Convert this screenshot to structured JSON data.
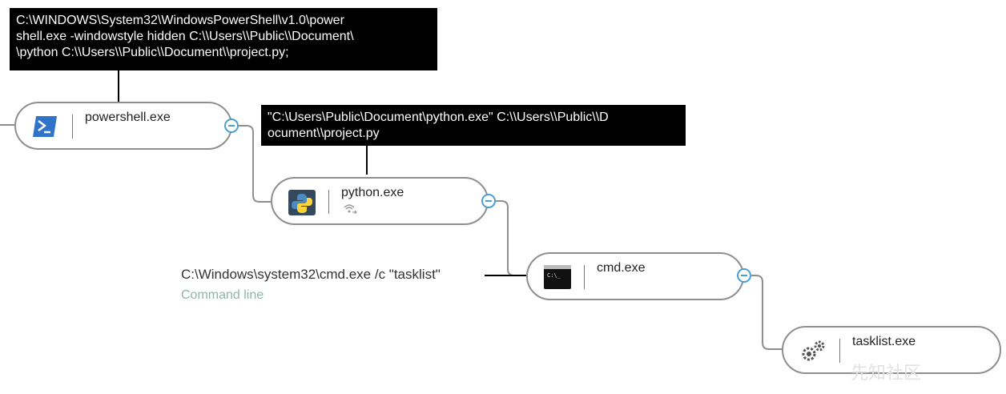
{
  "annotations": {
    "powershell_cmd": [
      "C:\\WINDOWS\\System32\\WindowsPowerShell\\v1.0\\power",
      "shell.exe -windowstyle hidden C:\\\\Users\\\\Public\\\\Document\\",
      "\\python C:\\\\Users\\\\Public\\\\Document\\\\project.py;"
    ],
    "python_cmd": [
      "\"C:\\Users\\Public\\Document\\python.exe\" C:\\\\Users\\\\Public\\\\D",
      "ocument\\\\project.py"
    ],
    "cmd_line": "C:\\Windows\\system32\\cmd.exe /c \"tasklist\"",
    "cmd_line_caption": "Command line"
  },
  "nodes": [
    {
      "label": "powershell.exe",
      "icon": "powershell-icon"
    },
    {
      "label": "python.exe",
      "icon": "python-icon",
      "badge": "network-activity-icon"
    },
    {
      "label": "cmd.exe",
      "icon": "cmd-console-icon"
    },
    {
      "label": "tasklist.exe",
      "icon": "gears-icon"
    }
  ],
  "watermark": "先知社区",
  "colors": {
    "node_border": "#8f8f8f",
    "toggle_accent": "#4a9fd1",
    "caption": "#8fb4ad"
  }
}
